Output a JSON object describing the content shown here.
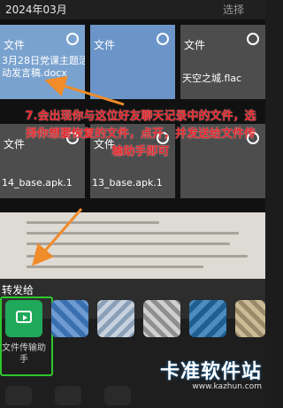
{
  "topbar": {
    "date": "2024年03月",
    "select_label": "选择"
  },
  "grid": {
    "tiles": [
      {
        "title": "文件",
        "name": "3月28日党课主题活\n动发言稿.docx"
      },
      {
        "title": "文件",
        "name": ""
      },
      {
        "title": "文件",
        "name": "天空之城.flac"
      },
      {
        "title": "文件",
        "name": "14_base.apk.1"
      },
      {
        "title": "文件",
        "name": "13_base.apk.1"
      },
      {
        "title": "",
        "name": ""
      }
    ]
  },
  "annotation": "7.会出现你与这位好友聊天记录中的文件，选择你想要恢复的文件，点开，并发送给文件传输助手即可",
  "share_sheet": {
    "title": "转发给",
    "helper_name": "文件传输助手"
  },
  "watermark": {
    "brand": "卡准软件站",
    "url": "www.kazhun.com"
  },
  "colors": {
    "accent": "#20a95a",
    "annotation": "#e6242a",
    "arrow": "#f08c2a",
    "highlight": "#2dc72d"
  }
}
